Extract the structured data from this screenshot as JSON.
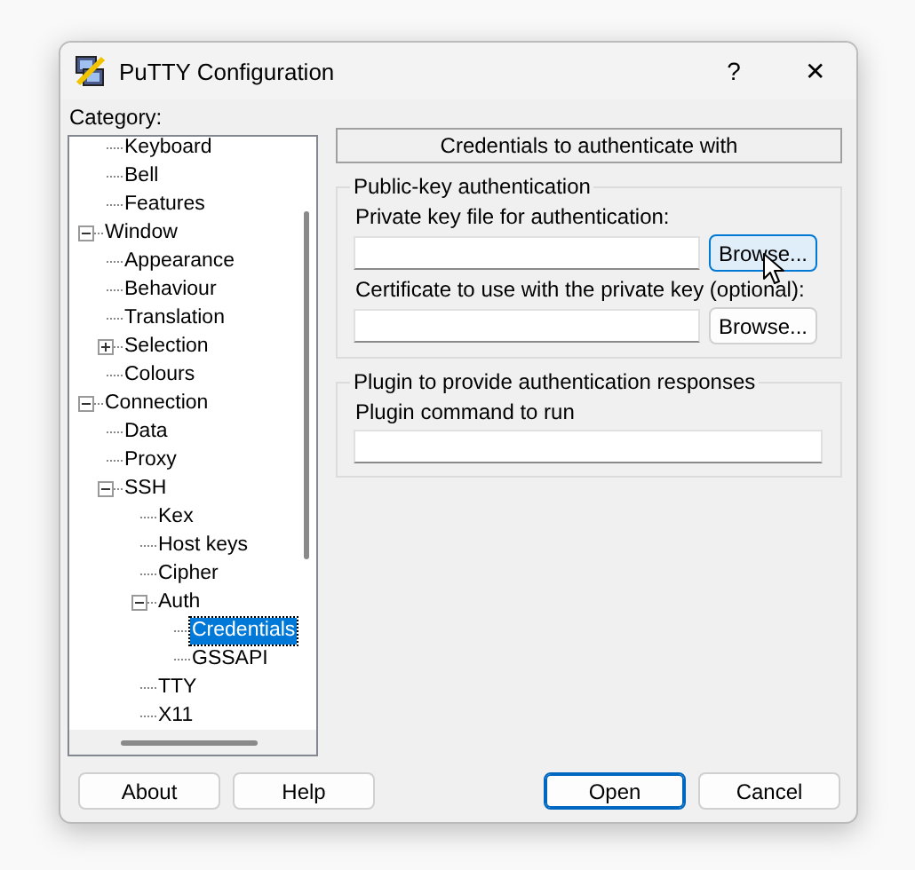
{
  "window": {
    "title": "PuTTY Configuration",
    "help_button": "?",
    "close_button": "✕"
  },
  "category": {
    "label": "Category:",
    "items": [
      {
        "children": [
          {
            "label": "Keyboard",
            "selected": false
          },
          {
            "label": "Bell",
            "selected": false
          },
          {
            "label": "Features",
            "selected": false
          }
        ]
      },
      {
        "label": "Window",
        "selected": false,
        "expanded": true,
        "children": [
          {
            "label": "Appearance",
            "selected": false
          },
          {
            "label": "Behaviour",
            "selected": false
          },
          {
            "label": "Translation",
            "selected": false
          },
          {
            "label": "Selection",
            "selected": false,
            "expanded": false
          },
          {
            "label": "Colours",
            "selected": false
          }
        ]
      },
      {
        "label": "Connection",
        "selected": false,
        "expanded": true,
        "children": [
          {
            "label": "Data",
            "selected": false
          },
          {
            "label": "Proxy",
            "selected": false
          },
          {
            "label": "SSH",
            "selected": false,
            "expanded": true,
            "children": [
              {
                "label": "Kex",
                "selected": false
              },
              {
                "label": "Host keys",
                "selected": false
              },
              {
                "label": "Cipher",
                "selected": false
              },
              {
                "label": "Auth",
                "selected": false,
                "expanded": true,
                "children": [
                  {
                    "label": "Credentials",
                    "selected": true
                  },
                  {
                    "label": "GSSAPI",
                    "selected": false
                  }
                ]
              },
              {
                "label": "TTY",
                "selected": false
              },
              {
                "label": "X11",
                "selected": false
              }
            ]
          }
        ]
      }
    ]
  },
  "panel": {
    "heading": "Credentials to authenticate with",
    "groups": [
      {
        "title": "Public-key authentication",
        "fields": [
          {
            "label": "Private key file for authentication:",
            "button": "Browse...",
            "hovered": true
          },
          {
            "label": "Certificate to use with the private key (optional):",
            "button": "Browse...",
            "hovered": false
          }
        ]
      },
      {
        "title": "Plugin to provide authentication responses",
        "fields": [
          {
            "label": "Plugin command to run"
          }
        ]
      }
    ]
  },
  "buttons": [
    {
      "label": "About",
      "default": false
    },
    {
      "label": "Help",
      "default": false
    },
    {
      "label": "Open",
      "default": true
    },
    {
      "label": "Cancel",
      "default": false
    }
  ]
}
